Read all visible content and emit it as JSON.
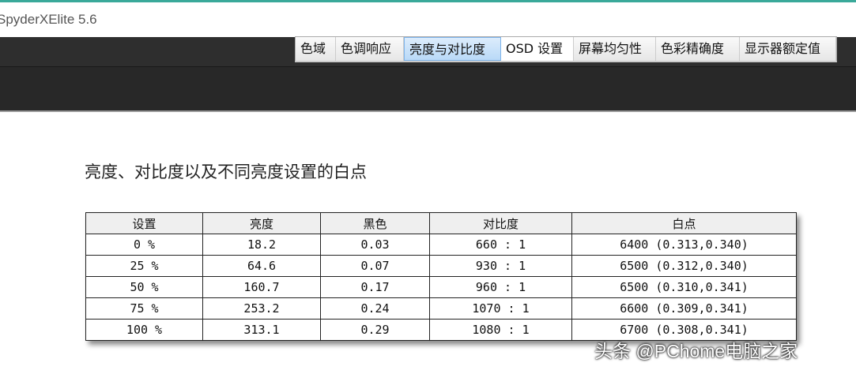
{
  "app": {
    "title": "SpyderXElite 5.6"
  },
  "tabs": [
    {
      "label": "色域"
    },
    {
      "label": "色调响应"
    },
    {
      "label": "亮度与对比度"
    },
    {
      "label": "OSD 设置"
    },
    {
      "label": "屏幕均匀性"
    },
    {
      "label": "色彩精确度"
    },
    {
      "label": "显示器额定值"
    }
  ],
  "section": {
    "title": "亮度、对比度以及不同亮度设置的白点"
  },
  "table": {
    "headers": [
      "设置",
      "亮度",
      "黑色",
      "对比度",
      "白点"
    ],
    "rows": [
      [
        "0 %",
        "18.2",
        "0.03",
        "660 : 1",
        "6400 (0.313,0.340)"
      ],
      [
        "25 %",
        "64.6",
        "0.07",
        "930 : 1",
        "6500 (0.312,0.340)"
      ],
      [
        "50 %",
        "160.7",
        "0.17",
        "960 : 1",
        "6500 (0.310,0.341)"
      ],
      [
        "75 %",
        "253.2",
        "0.24",
        "1070 : 1",
        "6600 (0.309,0.341)"
      ],
      [
        "100 %",
        "313.1",
        "0.29",
        "1080 : 1",
        "6700 (0.308,0.341)"
      ]
    ]
  },
  "watermark": "头条 @PChome电脑之家"
}
